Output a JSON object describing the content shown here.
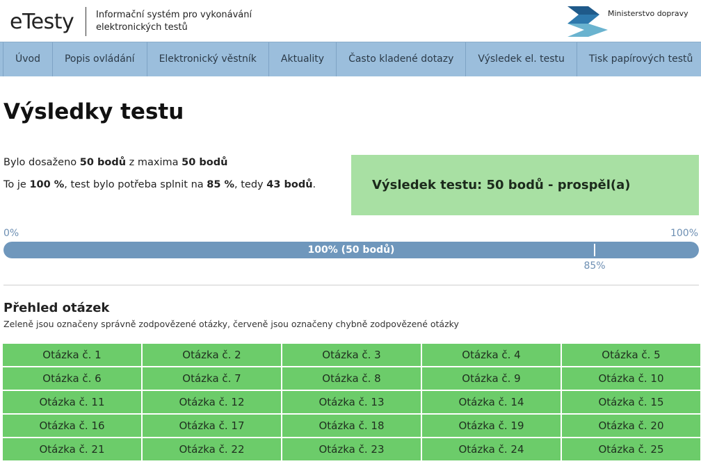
{
  "header": {
    "app_name": "eTesty",
    "subtitle_line1": "Informační systém pro vykonávání",
    "subtitle_line2": "elektronických testů",
    "ministry_name": "Ministerstvo dopravy",
    "logo_colors": [
      "#1f5a8a",
      "#6ab3cf"
    ]
  },
  "nav": {
    "items": [
      {
        "label": "Úvod"
      },
      {
        "label": "Popis ovládání"
      },
      {
        "label": "Elektronický věstník"
      },
      {
        "label": "Aktuality"
      },
      {
        "label": "Často kladené dotazy"
      },
      {
        "label": "Výsledek el. testu"
      },
      {
        "label": "Tisk papírových testů"
      }
    ]
  },
  "main": {
    "title": "Výsledky testu",
    "line1": {
      "p1": "Bylo dosaženo ",
      "b1": "50 bodů",
      "p2": " z maxima ",
      "b2": "50 bodů"
    },
    "line2": {
      "p1": "To je ",
      "b1": "100 %",
      "p2": ", test bylo potřeba splnit na ",
      "b2": "85 %",
      "p3": ", tedy ",
      "b3": "43 bodů",
      "p4": "."
    },
    "result_text": "Výsledek testu: 50 bodů - prospěl(a)",
    "result_color": "#a8e0a3"
  },
  "progress": {
    "min_label": "0%",
    "max_label": "100%",
    "bar_label": "100% (50 bodů)",
    "value": 1.0,
    "threshold": 0.85,
    "threshold_label": "85%",
    "fill_color": "#6f97bc"
  },
  "overview": {
    "title": "Přehled otázek",
    "description": "Zeleně jsou označeny správně zodpovězené otázky, červeně jsou označeny chybně zodpovězené otázky",
    "correct_color": "#6ccc6a",
    "questions": [
      "Otázka č. 1",
      "Otázka č. 2",
      "Otázka č. 3",
      "Otázka č. 4",
      "Otázka č. 5",
      "Otázka č. 6",
      "Otázka č. 7",
      "Otázka č. 8",
      "Otázka č. 9",
      "Otázka č. 10",
      "Otázka č. 11",
      "Otázka č. 12",
      "Otázka č. 13",
      "Otázka č. 14",
      "Otázka č. 15",
      "Otázka č. 16",
      "Otázka č. 17",
      "Otázka č. 18",
      "Otázka č. 19",
      "Otázka č. 20",
      "Otázka č. 21",
      "Otázka č. 22",
      "Otázka č. 23",
      "Otázka č. 24",
      "Otázka č. 25"
    ]
  }
}
